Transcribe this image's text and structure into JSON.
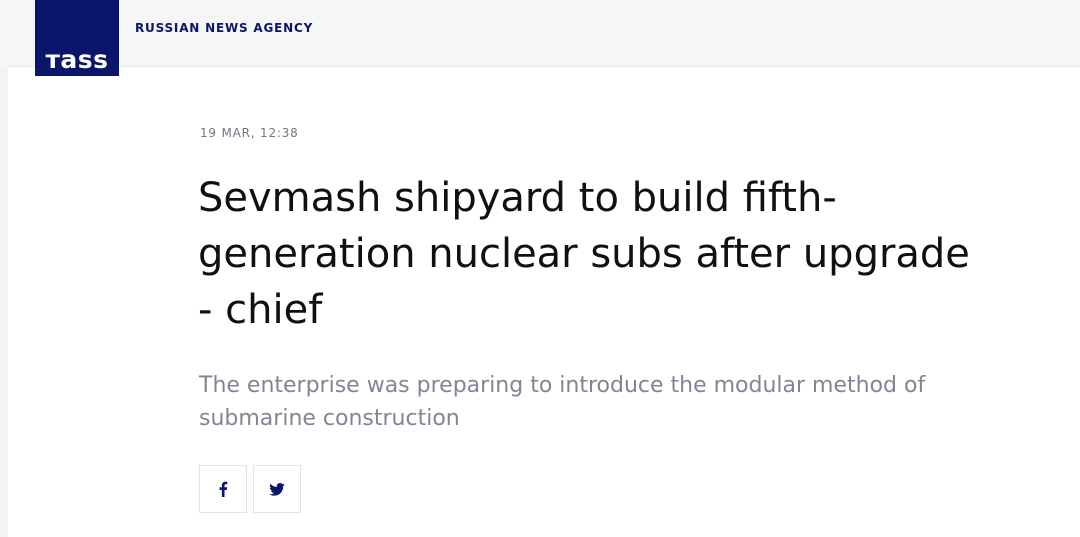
{
  "brand": {
    "logo_text": "тass",
    "agency_name": "RUSSIAN NEWS AGENCY",
    "color": "#0b1569"
  },
  "article": {
    "date": "19 MAR, 12:38",
    "headline": "Sevmash shipyard to build fifth-generation nuclear subs after upgrade - chief",
    "lead": "The enterprise was preparing to introduce the modular method of submarine construction"
  },
  "share": {
    "buttons": [
      {
        "icon": "facebook-icon"
      },
      {
        "icon": "twitter-icon"
      }
    ]
  }
}
